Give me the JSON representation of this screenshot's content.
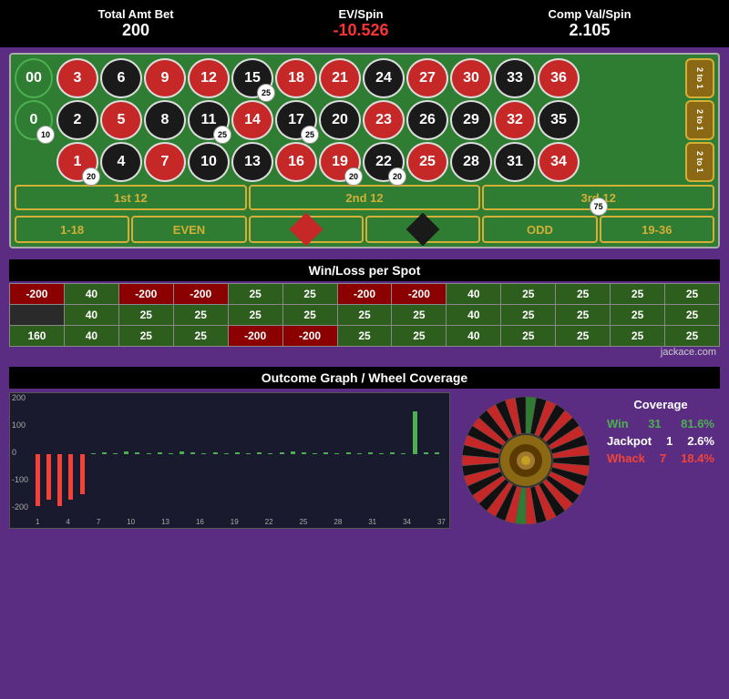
{
  "header": {
    "totalAmtBet_label": "Total Amt Bet",
    "totalAmtBet_value": "200",
    "evSpin_label": "EV/Spin",
    "evSpin_value": "-10.526",
    "compValSpin_label": "Comp Val/Spin",
    "compValSpin_value": "2.105"
  },
  "table": {
    "zeros": [
      "00",
      "0"
    ],
    "col2to1": [
      "2 to 1",
      "2 to 1",
      "2 to 1"
    ],
    "dozens": [
      "1st 12",
      "2nd 12",
      "3rd 12"
    ],
    "bottom": [
      "1-18",
      "EVEN",
      "",
      "",
      "ODD",
      "19-36"
    ],
    "chips": {
      "zero_00": null,
      "zero_0": "10",
      "row1_col4": "25",
      "row2_col4": "25",
      "row2_col6": "25",
      "row3_chip": "20",
      "col22_chip": "20",
      "dozen3_chip": "75"
    }
  },
  "winloss": {
    "title": "Win/Loss per Spot",
    "rows": [
      [
        "-200",
        "40",
        "-200",
        "-200",
        "25",
        "25",
        "-200",
        "-200",
        "40",
        "25",
        "25",
        "25",
        "25"
      ],
      [
        "",
        "40",
        "25",
        "25",
        "25",
        "25",
        "25",
        "25",
        "40",
        "25",
        "25",
        "25",
        "25"
      ],
      [
        "160",
        "40",
        "25",
        "25",
        "-200",
        "-200",
        "25",
        "25",
        "40",
        "25",
        "25",
        "25",
        "25"
      ]
    ]
  },
  "outcome": {
    "title": "Outcome Graph / Wheel Coverage",
    "yLabels": [
      "200",
      "100",
      "0",
      "-100",
      "-200"
    ],
    "xLabels": [
      "1",
      "4",
      "7",
      "10",
      "13",
      "16",
      "19",
      "22",
      "25",
      "28",
      "31",
      "34",
      "37"
    ],
    "bars": [
      {
        "x": 0,
        "val": -180
      },
      {
        "x": 1,
        "val": -160
      },
      {
        "x": 2,
        "val": -180
      },
      {
        "x": 3,
        "val": -160
      },
      {
        "x": 4,
        "val": -140
      },
      {
        "x": 5,
        "val": 0
      },
      {
        "x": 6,
        "val": 5
      },
      {
        "x": 7,
        "val": 0
      },
      {
        "x": 8,
        "val": 10
      },
      {
        "x": 9,
        "val": 5
      },
      {
        "x": 10,
        "val": 0
      },
      {
        "x": 11,
        "val": 5
      },
      {
        "x": 12,
        "val": 0
      },
      {
        "x": 13,
        "val": 10
      },
      {
        "x": 14,
        "val": 5
      },
      {
        "x": 15,
        "val": 0
      },
      {
        "x": 16,
        "val": 5
      },
      {
        "x": 17,
        "val": 0
      },
      {
        "x": 18,
        "val": 5
      },
      {
        "x": 19,
        "val": 0
      },
      {
        "x": 20,
        "val": 5
      },
      {
        "x": 21,
        "val": 0
      },
      {
        "x": 22,
        "val": 5
      },
      {
        "x": 23,
        "val": 10
      },
      {
        "x": 24,
        "val": 5
      },
      {
        "x": 25,
        "val": 0
      },
      {
        "x": 26,
        "val": 5
      },
      {
        "x": 27,
        "val": 0
      },
      {
        "x": 28,
        "val": 5
      },
      {
        "x": 29,
        "val": 0
      },
      {
        "x": 30,
        "val": 5
      },
      {
        "x": 31,
        "val": 0
      },
      {
        "x": 32,
        "val": 5
      },
      {
        "x": 33,
        "val": 0
      },
      {
        "x": 34,
        "val": 150
      },
      {
        "x": 35,
        "val": 5
      },
      {
        "x": 36,
        "val": 5
      }
    ]
  },
  "coverage": {
    "title": "Coverage",
    "win_label": "Win",
    "win_count": "31",
    "win_pct": "81.6%",
    "jackpot_label": "Jackpot",
    "jackpot_count": "1",
    "jackpot_pct": "2.6%",
    "whack_label": "Whack",
    "whack_count": "7",
    "whack_pct": "18.4%"
  },
  "credit": "jackace.com",
  "numbers": {
    "layout": [
      [
        3,
        6,
        9,
        12,
        15,
        18,
        21,
        24,
        27,
        30,
        33,
        36
      ],
      [
        2,
        5,
        8,
        11,
        14,
        17,
        20,
        23,
        26,
        29,
        32,
        35
      ],
      [
        1,
        4,
        7,
        10,
        13,
        16,
        19,
        22,
        25,
        28,
        31,
        34
      ]
    ],
    "red": [
      1,
      3,
      5,
      7,
      9,
      12,
      14,
      16,
      18,
      19,
      21,
      23,
      25,
      27,
      30,
      32,
      34,
      36
    ],
    "black": [
      2,
      4,
      6,
      8,
      10,
      11,
      13,
      15,
      17,
      20,
      22,
      24,
      26,
      28,
      29,
      31,
      33,
      35
    ]
  }
}
